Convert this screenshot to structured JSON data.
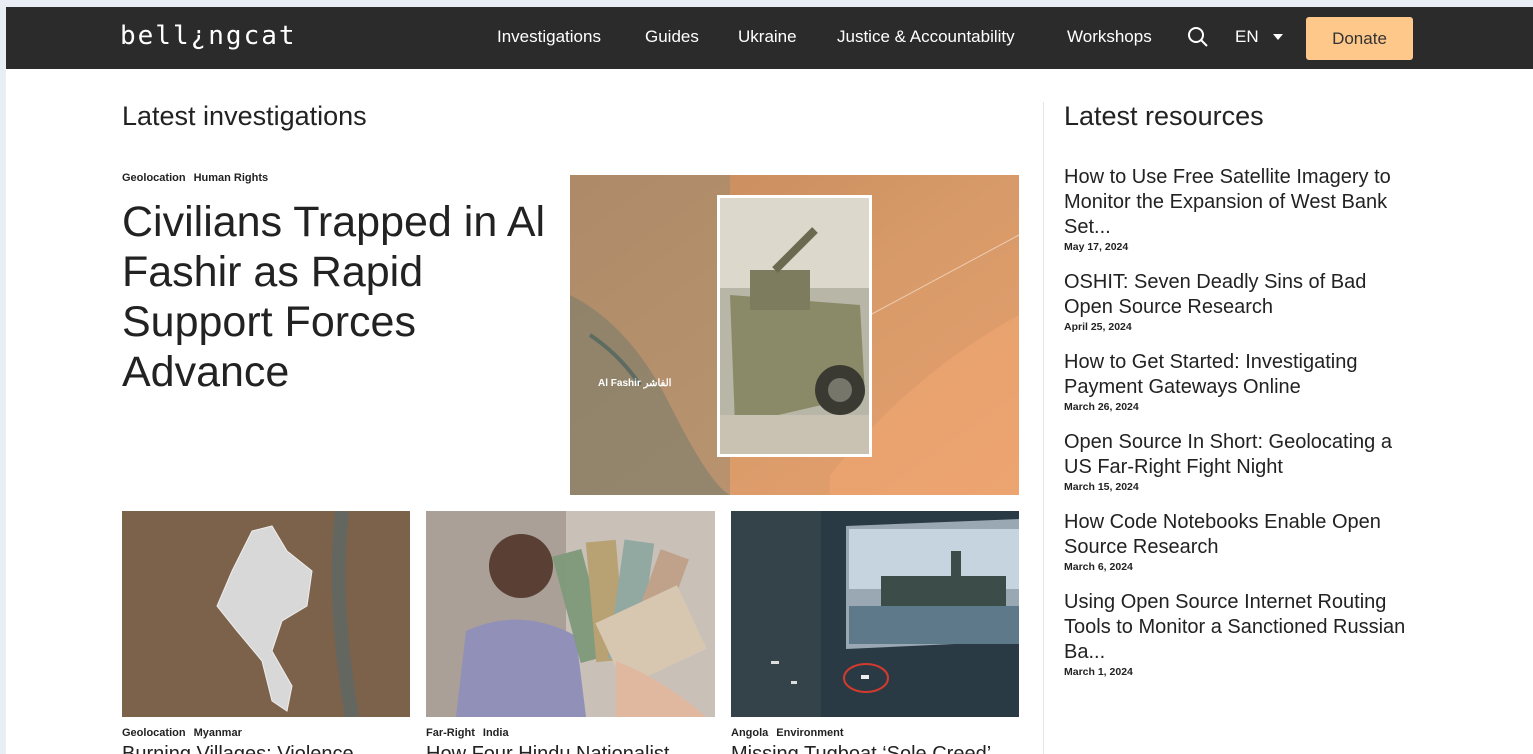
{
  "header": {
    "logo": "bell¿ngcat",
    "nav": [
      {
        "label": "Investigations"
      },
      {
        "label": "Guides"
      },
      {
        "label": "Ukraine"
      },
      {
        "label": "Justice & Accountability"
      },
      {
        "label": "Workshops"
      }
    ],
    "search_icon": "search-icon",
    "language": "EN",
    "donate_label": "Donate"
  },
  "investigations": {
    "section_title": "Latest investigations",
    "featured": {
      "tags": [
        "Geolocation",
        "Human Rights"
      ],
      "title": "Civilians Trapped in Al Fashir as Rapid Support Forces Advance",
      "map_label": "Al Fashir الفاشر"
    },
    "cards": [
      {
        "tags": [
          "Geolocation",
          "Myanmar"
        ],
        "title": "Burning Villages: Violence"
      },
      {
        "tags": [
          "Far-Right",
          "India"
        ],
        "title": "How Four Hindu Nationalist"
      },
      {
        "tags": [
          "Angola",
          "Environment"
        ],
        "title": "Missing Tugboat ‘Sole Creed’"
      }
    ]
  },
  "resources": {
    "section_title": "Latest resources",
    "items": [
      {
        "title": "How to Use Free Satellite Imagery to Monitor the Expansion of West Bank Set...",
        "date": "May 17, 2024"
      },
      {
        "title": "OSHIT: Seven Deadly Sins of Bad Open Source Research",
        "date": "April 25, 2024"
      },
      {
        "title": "How to Get Started: Investigating Payment Gateways Online",
        "date": "March 26, 2024"
      },
      {
        "title": "Open Source In Short: Geolocating a US Far-Right Fight Night",
        "date": "March 15, 2024"
      },
      {
        "title": "How Code Notebooks Enable Open Source Research",
        "date": "March 6, 2024"
      },
      {
        "title": "Using Open Source Internet Routing Tools to Monitor a Sanctioned Russian Ba...",
        "date": "March 1, 2024"
      }
    ]
  },
  "colors": {
    "header_bg": "#2b2b2b",
    "donate_bg": "#fdc88a",
    "text": "#222222"
  }
}
